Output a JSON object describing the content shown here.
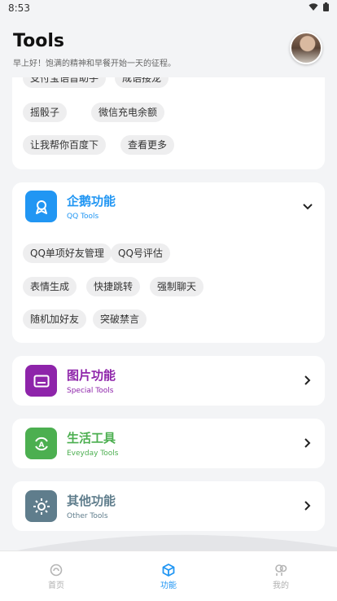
{
  "status": {
    "time": "8:53"
  },
  "header": {
    "title": "Tools",
    "subtitle": "早上好！饱满的精神和早餐开始一天的征程。"
  },
  "top_card": {
    "chips": [
      "支付宝语音助手",
      "成语接龙",
      "摇骰子",
      "微信充电余额",
      "让我帮你百度下",
      "查看更多"
    ]
  },
  "qq_section": {
    "title": "企鹅功能",
    "subtitle": "QQ Tools",
    "color": "#2196f3",
    "chips": [
      "QQ单项好友管理",
      "QQ号评估",
      "表情生成",
      "快捷跳转",
      "强制聊天",
      "随机加好友",
      "突破禁言"
    ]
  },
  "image_section": {
    "title": "图片功能",
    "subtitle": "Special Tools",
    "color": "#8e24aa"
  },
  "life_section": {
    "title": "生活工具",
    "subtitle": "Eveyday Tools",
    "color": "#4caf50"
  },
  "other_section": {
    "title": "其他功能",
    "subtitle": "Other Tools",
    "color": "#5f7d8c"
  },
  "bottom_nav": {
    "items": [
      {
        "label": "首页",
        "icon": "home-icon"
      },
      {
        "label": "功能",
        "icon": "cube-icon"
      },
      {
        "label": "我的",
        "icon": "profile-icon"
      }
    ],
    "active": "功能",
    "active_color": "#2196f3"
  }
}
